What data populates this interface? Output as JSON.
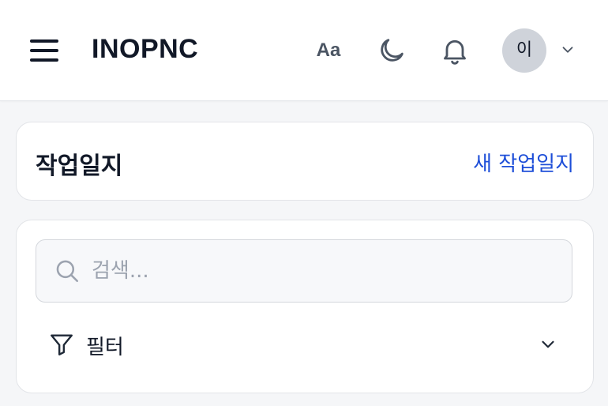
{
  "header": {
    "brand": "INOPNC",
    "font_size_label": "Aa",
    "user_initial": "이",
    "icons": [
      "menu-icon",
      "moon-icon",
      "bell-icon",
      "chevron-down-icon"
    ]
  },
  "page": {
    "title": "작업일지",
    "new_report_label": "새 작업일지"
  },
  "search": {
    "placeholder": "검색...",
    "value": ""
  },
  "filter": {
    "label": "필터",
    "icons": [
      "filter-icon",
      "chevron-down-icon"
    ]
  },
  "colors": {
    "accent": "#1d4ed8",
    "background": "#f5f6f8",
    "avatar_bg": "#cfd3da"
  }
}
